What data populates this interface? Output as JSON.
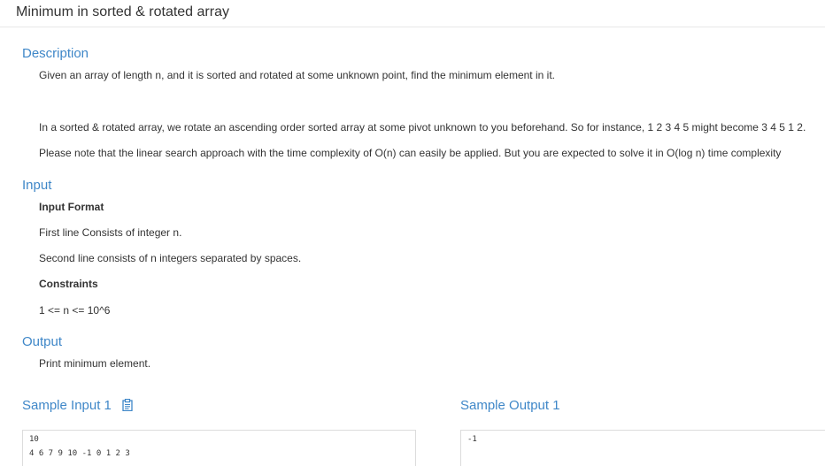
{
  "title": "Minimum in sorted & rotated array",
  "description": {
    "heading": "Description",
    "paragraphs": [
      "Given an array of length n, and it is sorted and rotated at some unknown point, find the minimum element in it.",
      "In a sorted & rotated array,  we rotate an ascending order sorted array at some pivot unknown to you beforehand. So for instance, 1 2 3 4 5 might become 3 4 5 1 2.",
      "Please note that the linear search approach with the time complexity of O(n) can easily be applied. But you are expected to solve it in O(log n) time complexity"
    ]
  },
  "input": {
    "heading": "Input",
    "format_label": "Input Format",
    "lines": [
      "First line Consists of integer n.",
      "Second line consists of n integers separated by spaces."
    ],
    "constraints_label": "Constraints",
    "constraint": "1 <= n <= 10^6"
  },
  "output": {
    "heading": "Output",
    "text": "Print minimum element."
  },
  "samples": {
    "input_heading": "Sample Input 1",
    "output_heading": "Sample Output 1",
    "input_lines": [
      "10",
      "4 6 7 9 10 -1 0 1 2 3"
    ],
    "output_lines": [
      "-1"
    ],
    "copy_icon": "clipboard-icon"
  },
  "colors": {
    "accent": "#3f87c8",
    "text": "#333333",
    "border": "#dcdcdc"
  }
}
